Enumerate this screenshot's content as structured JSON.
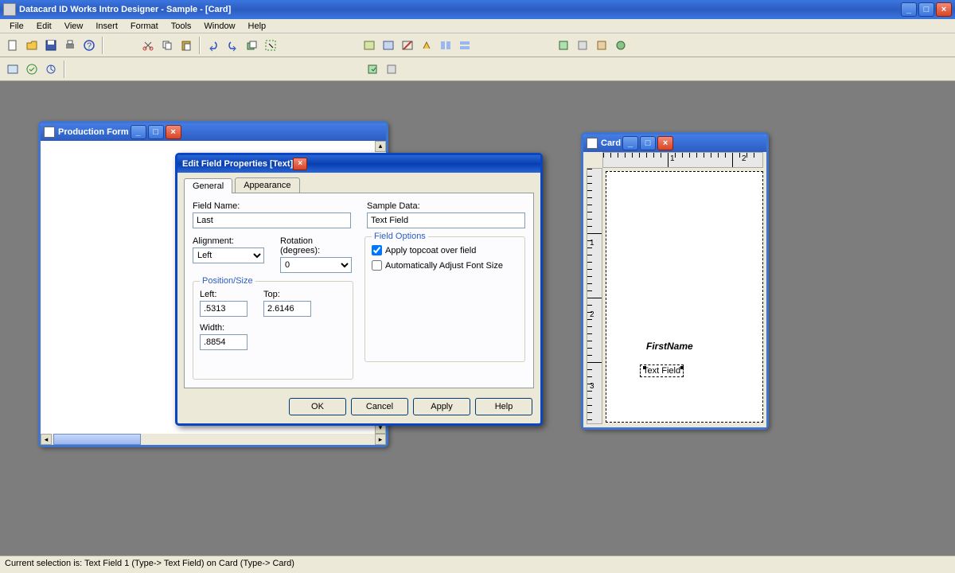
{
  "app": {
    "title": "Datacard ID Works Intro Designer - Sample - [Card]"
  },
  "menu": {
    "items": [
      "File",
      "Edit",
      "View",
      "Insert",
      "Format",
      "Tools",
      "Window",
      "Help"
    ]
  },
  "mdi": {
    "prod": {
      "title": "Production Form"
    },
    "card": {
      "title": "Card",
      "field1": "FirstName",
      "field2": "Text Field",
      "ruler_h": [
        "1",
        "2"
      ],
      "ruler_v": [
        "1",
        "2",
        "3"
      ]
    }
  },
  "dialog": {
    "title": "Edit Field Properties [Text]",
    "tabs": {
      "general": "General",
      "appearance": "Appearance"
    },
    "labels": {
      "fieldName": "Field Name:",
      "sampleData": "Sample Data:",
      "alignment": "Alignment:",
      "rotation": "Rotation (degrees):",
      "posSize": "Position/Size",
      "left": "Left:",
      "top": "Top:",
      "width": "Width:",
      "fieldOptions": "Field Options",
      "topcoat": "Apply topcoat over field",
      "autoFont": "Automatically Adjust Font Size"
    },
    "values": {
      "fieldName": "Last",
      "sampleData": "Text Field",
      "alignment": "Left",
      "rotation": "0",
      "left": ".5313",
      "top": "2.6146",
      "width": ".8854"
    },
    "buttons": {
      "ok": "OK",
      "cancel": "Cancel",
      "apply": "Apply",
      "help": "Help"
    }
  },
  "status": "Current selection is: Text Field 1 (Type-> Text Field) on Card (Type-> Card)"
}
